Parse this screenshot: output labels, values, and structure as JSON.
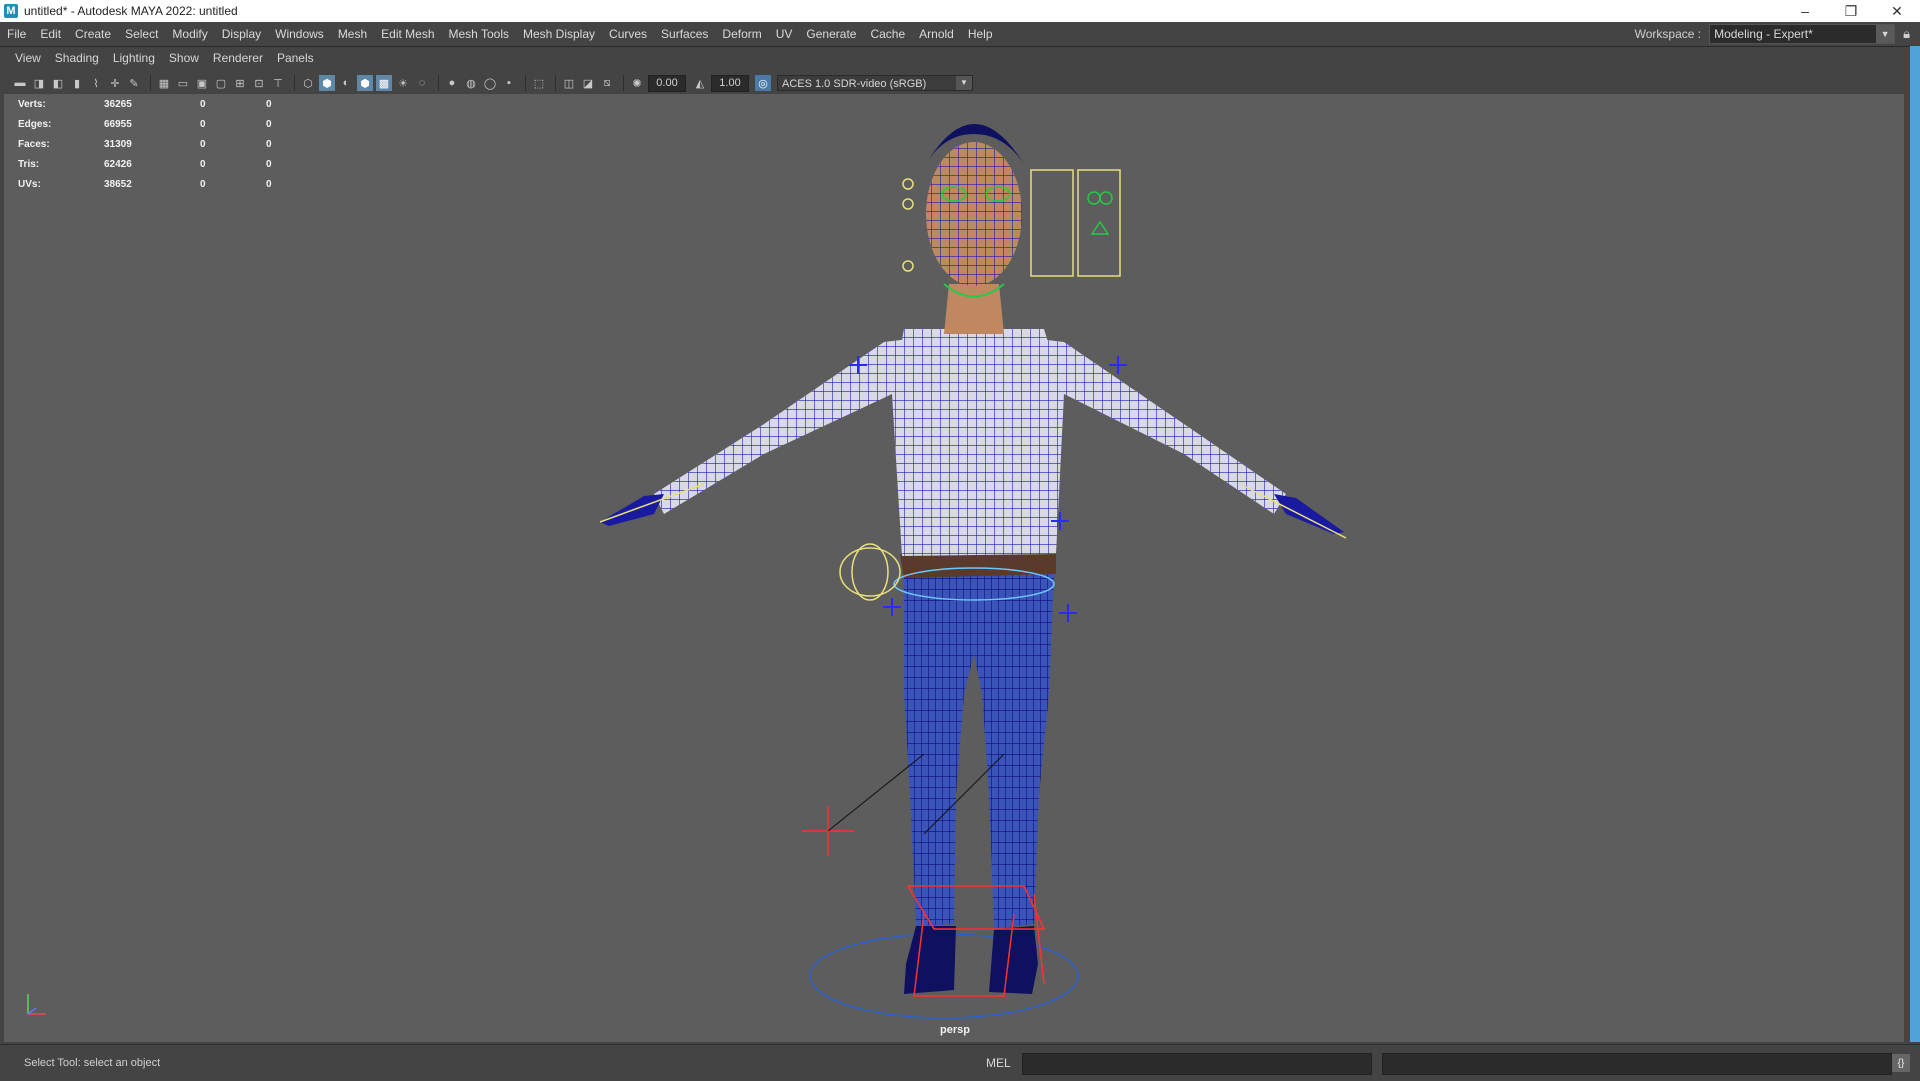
{
  "window": {
    "title": "untitled* - Autodesk MAYA 2022: untitled",
    "app_icon": "M",
    "controls": {
      "minimize": "–",
      "restore": "❐",
      "close": "✕"
    }
  },
  "menu": [
    {
      "label": "File"
    },
    {
      "label": "Edit"
    },
    {
      "label": "Create"
    },
    {
      "label": "Select"
    },
    {
      "label": "Modify"
    },
    {
      "label": "Display"
    },
    {
      "label": "Windows"
    },
    {
      "label": "Mesh"
    },
    {
      "label": "Edit Mesh"
    },
    {
      "label": "Mesh Tools"
    },
    {
      "label": "Mesh Display"
    },
    {
      "label": "Curves"
    },
    {
      "label": "Surfaces"
    },
    {
      "label": "Deform"
    },
    {
      "label": "UV"
    },
    {
      "label": "Generate"
    },
    {
      "label": "Cache"
    },
    {
      "label": "Arnold"
    },
    {
      "label": "Help"
    }
  ],
  "workspace": {
    "label": "Workspace :",
    "value": "Modeling - Expert*",
    "lock_icon": "lock-icon"
  },
  "panel_menus": [
    {
      "label": "View"
    },
    {
      "label": "Shading"
    },
    {
      "label": "Lighting"
    },
    {
      "label": "Show"
    },
    {
      "label": "Renderer"
    },
    {
      "label": "Panels"
    }
  ],
  "toolbar": {
    "exposure": "0.00",
    "gamma": "1.00",
    "color_management": "ACES 1.0 SDR-video (sRGB)"
  },
  "hud": {
    "rows": [
      {
        "label": "Verts:",
        "v1": "36265",
        "v2": "0",
        "v3": "0"
      },
      {
        "label": "Edges:",
        "v1": "66955",
        "v2": "0",
        "v3": "0"
      },
      {
        "label": "Faces:",
        "v1": "31309",
        "v2": "0",
        "v3": "0"
      },
      {
        "label": "Tris:",
        "v1": "62426",
        "v2": "0",
        "v3": "0"
      },
      {
        "label": "UVs:",
        "v1": "38652",
        "v2": "0",
        "v3": "0"
      }
    ]
  },
  "viewport": {
    "camera": "persp"
  },
  "status": {
    "help_line": "Select Tool: select an object",
    "mel_label": "MEL"
  },
  "colors": {
    "viewport_bg": "#5d5d5d",
    "ui_bg": "#444444",
    "accent": "#4fa3d9",
    "wire": "#1a1a9a"
  }
}
